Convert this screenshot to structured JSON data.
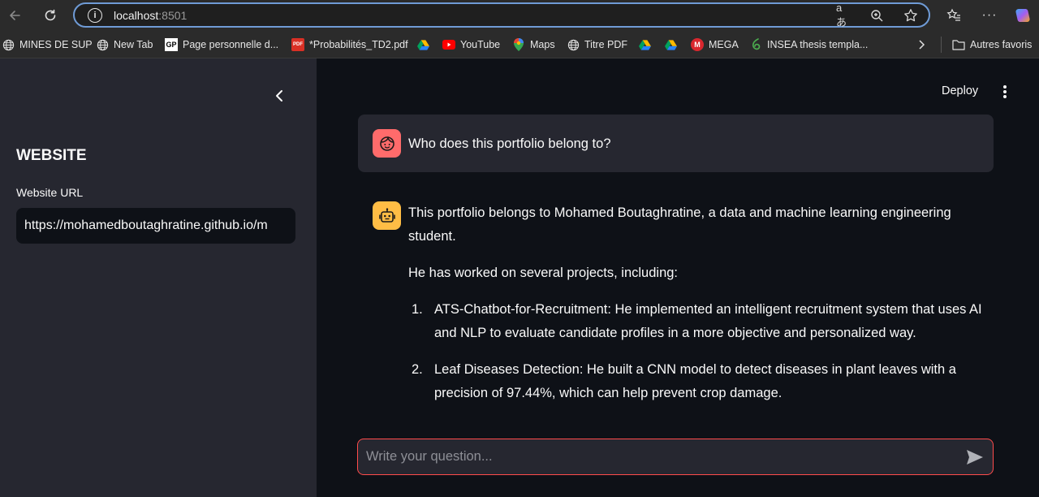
{
  "browser": {
    "url_host": "localhost",
    "url_port": ":8501",
    "bookmarks": [
      {
        "label": "MINES DE SUP",
        "icon": "globe-icon"
      },
      {
        "label": "New Tab",
        "icon": "globe-icon"
      },
      {
        "label": "Page personnelle d...",
        "icon": "gp-icon"
      },
      {
        "label": "*Probabilités_TD2.pdf",
        "icon": "pdf-icon"
      },
      {
        "label": "",
        "icon": "drive-icon"
      },
      {
        "label": "YouTube",
        "icon": "youtube-icon"
      },
      {
        "label": "Maps",
        "icon": "maps-icon"
      },
      {
        "label": "Titre PDF",
        "icon": "globe-icon"
      },
      {
        "label": "",
        "icon": "drive-icon"
      },
      {
        "label": "",
        "icon": "drive-icon"
      },
      {
        "label": "MEGA",
        "icon": "mega-icon"
      },
      {
        "label": "INSEA thesis templa...",
        "icon": "overleaf-icon"
      }
    ],
    "other_favorites": "Autres favoris"
  },
  "sidebar": {
    "title": "WEBSITE",
    "url_label": "Website URL",
    "url_value": "https://mohamedboutaghratine.github.io/m"
  },
  "header": {
    "deploy_label": "Deploy"
  },
  "chat": {
    "user_message": "Who does this portfolio belong to?",
    "bot_intro": "This portfolio belongs to Mohamed Boutaghratine, a data and machine learning engineering student.",
    "bot_projects_intro": "He has worked on several projects, including:",
    "bot_projects": [
      {
        "num": "1.",
        "text": "ATS-Chatbot-for-Recruitment: He implemented an intelligent recruitment system that uses AI and NLP to evaluate candidate profiles in a more objective and personalized way."
      },
      {
        "num": "2.",
        "text": "Leaf Diseases Detection: He built a CNN model to detect diseases in plant leaves with a precision of 97.44%, which can help prevent crop damage."
      }
    ],
    "input_placeholder": "Write your question..."
  },
  "colors": {
    "app_bg": "#0e1117",
    "sidebar_bg": "#262730",
    "accent": "#ff4b4b",
    "user_avatar": "#ff6b6b",
    "bot_avatar": "#ffbd45"
  }
}
